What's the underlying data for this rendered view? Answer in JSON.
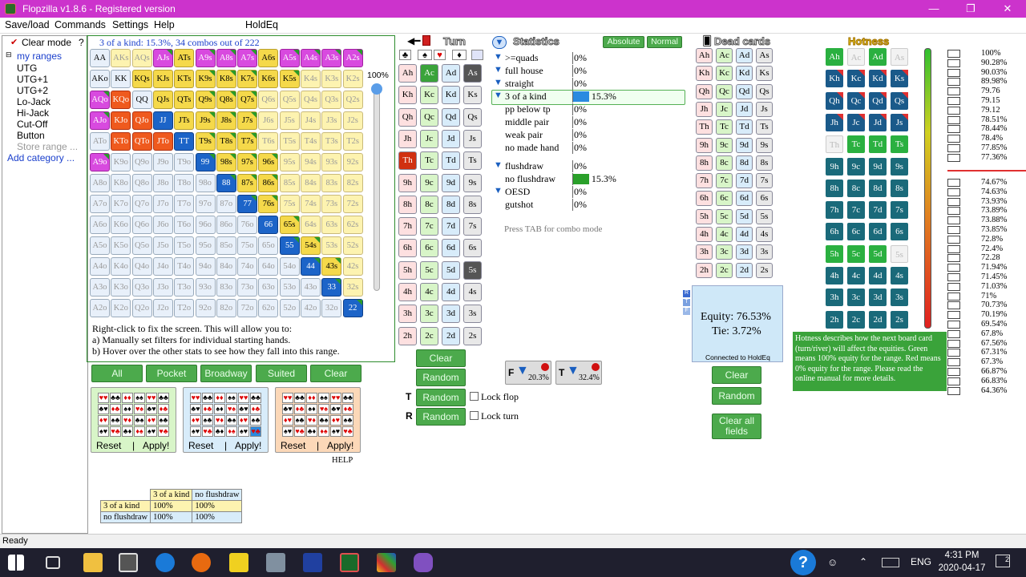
{
  "window": {
    "title": "Flopzilla v1.8.6 - Registered version",
    "min": "—",
    "max": "❐",
    "close": "✕"
  },
  "menu": [
    "Save/load",
    "Commands",
    "Settings",
    "Help",
    "HoldEq"
  ],
  "menu_help_q": "?",
  "left": {
    "clear_mode": "Clear mode",
    "items": [
      "my ranges",
      "UTG",
      "UTG+1",
      "UTG+2",
      "Lo-Jack",
      "Hi-Jack",
      "Cut-Off",
      "Button"
    ],
    "store_range": "Store range ...",
    "add_category": "Add category ..."
  },
  "range": {
    "header": "3 of a kind: 15.3%, 34 combos out of 222",
    "slider_pct": "100%",
    "help_text": [
      "Right-click to fix the screen. This will allow you to:",
      "a) Manually set filters for individual starting hands.",
      "b) Hover over the other stats to see how they fall into this range."
    ],
    "buttons": [
      "All",
      "Pocket",
      "Broadway",
      "Suited",
      "Clear"
    ],
    "suit_boxes": [
      {
        "reset": "Reset",
        "sep": "|",
        "apply": "Apply!"
      },
      {
        "reset": "Reset",
        "sep": "|",
        "apply": "Apply!"
      },
      {
        "reset": "Reset",
        "sep": "|",
        "apply": "Apply!"
      }
    ],
    "help_link": "HELP"
  },
  "filter_table": {
    "cols": [
      "3 of a kind",
      "no flushdraw"
    ],
    "rows": [
      {
        "label": "3 of a kind",
        "vals": [
          "100%",
          "100%"
        ]
      },
      {
        "label": "no flushdraw",
        "vals": [
          "100%",
          "100%"
        ]
      }
    ]
  },
  "board": {
    "turn_label": "Turn",
    "suits": [
      "♣",
      "♠",
      "♥",
      "♦"
    ],
    "clear": "Clear",
    "random": "Random",
    "flop_random": "Random",
    "turn_random": "Random",
    "lock_flop": "Lock flop",
    "lock_turn": "Lock turn",
    "flop_letter": "T",
    "turn_letter": "R"
  },
  "stats": {
    "title": "Statistics",
    "absolute": "Absolute",
    "normal": "Normal",
    "rows": [
      {
        "label": ">=quads",
        "pct": "0%",
        "value": 0
      },
      {
        "label": "full house",
        "pct": "0%",
        "value": 0
      },
      {
        "label": "straight",
        "pct": "0%",
        "value": 0
      },
      {
        "label": "3 of a kind",
        "pct": "15.3%",
        "value": 15.3
      },
      {
        "label": "pp below tp",
        "pct": "0%",
        "value": 0
      },
      {
        "label": "middle pair",
        "pct": "0%",
        "value": 0
      },
      {
        "label": "weak pair",
        "pct": "0%",
        "value": 0
      },
      {
        "label": "no made hand",
        "pct": "0%",
        "value": 0
      },
      {
        "label": "flushdraw",
        "pct": "0%",
        "value": 0
      },
      {
        "label": "no flushdraw",
        "pct": "15.3%",
        "value": 15.3
      },
      {
        "label": "OESD",
        "pct": "0%",
        "value": 0
      },
      {
        "label": "gutshot",
        "pct": "0%",
        "value": 0
      }
    ],
    "tab_hint": "Press TAB for combo mode",
    "filter1": "20.3%",
    "filter2": "32.4%",
    "f1_letter": "F",
    "f2_letter": "T"
  },
  "dead": {
    "title": "Dead cards",
    "clear": "Clear",
    "random": "Random",
    "clear_all": "Clear all fields",
    "equity": "Equity: 76.53%",
    "tie": "Tie: 3.72%",
    "connected": "Connected to HoldEq"
  },
  "hotness": {
    "title": "Hotness",
    "tooltip": "Hotness describes how the next board card (turn/river) will affect the equities. Green means 100% equity for the range. Red means 0% equity for the range. Please read the online manual for more details.",
    "list1": [
      "100%",
      "90.28%",
      "90.03%",
      "89.98%",
      "79.76",
      "79.15",
      "79.12",
      "78.51%",
      "78.44%",
      "78.4%",
      "77.85%",
      "77.36%"
    ],
    "list2": [
      "74.67%",
      "74.63%",
      "73.93%",
      "73.89%",
      "73.88%",
      "73.85%",
      "72.8%",
      "72.4%",
      "72.28",
      "71.94%",
      "71.45%",
      "71.03%",
      "71%",
      "70.73%",
      "70.19%",
      "69.54%",
      "67.8%",
      "67.56%",
      "67.31%",
      "67.3%",
      "66.87%",
      "66.83%",
      "64.36%"
    ]
  },
  "status": "Ready",
  "taskbar": {
    "time": "4:31 PM",
    "date": "2020-04-17",
    "lang": "ENG",
    "notif": "2"
  }
}
